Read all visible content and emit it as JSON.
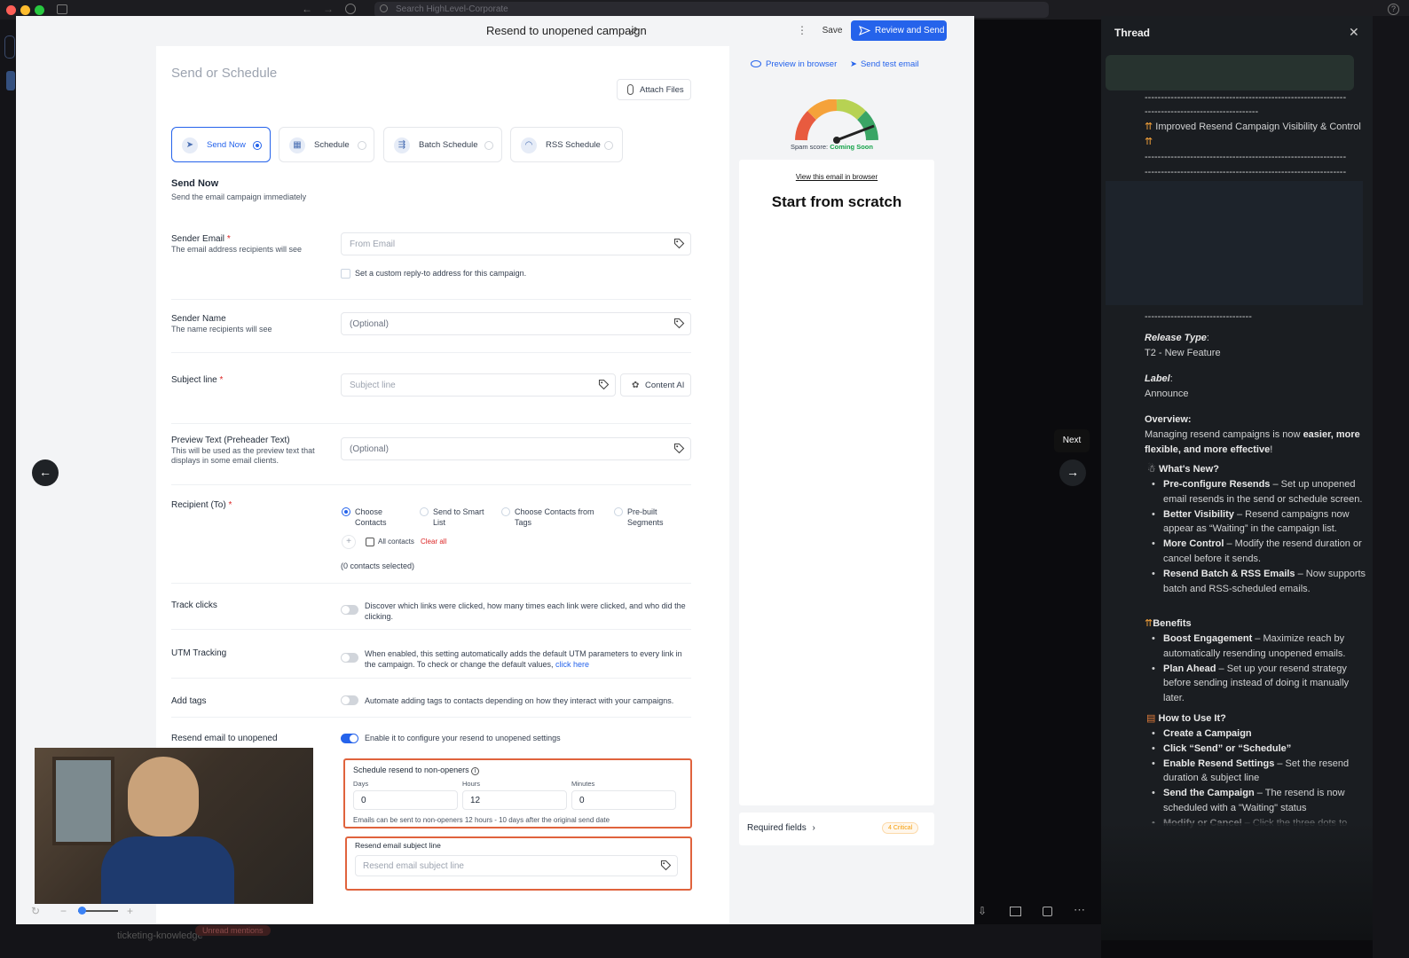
{
  "browser": {
    "search_placeholder": "Search HighLevel-Corporate"
  },
  "modal": {
    "title": "Resend to unopened campaign",
    "save": "Save",
    "review_send": "Review and Send",
    "preview_in_browser": "Preview in browser",
    "send_test": "Send test email",
    "attach_files": "Attach Files",
    "section_heading": "Send or Schedule"
  },
  "tabs": [
    {
      "label": "Send Now",
      "selected": true
    },
    {
      "label": "Schedule"
    },
    {
      "label": "Batch Schedule"
    },
    {
      "label": "RSS Schedule"
    }
  ],
  "send_now": {
    "title": "Send Now",
    "desc": "Send the email campaign immediately"
  },
  "fields": {
    "sender_email": {
      "label": "Sender Email",
      "desc": "The email address recipients will see",
      "placeholder": "From Email",
      "reply_to": "Set a custom reply-to address for this campaign."
    },
    "sender_name": {
      "label": "Sender Name",
      "desc": "The name recipients will see",
      "placeholder": "(Optional)"
    },
    "subject": {
      "label": "Subject line",
      "placeholder": "Subject line",
      "content_ai": "Content AI"
    },
    "preview_text": {
      "label": "Preview Text (Preheader Text)",
      "desc": "This will be used as the preview text that displays in some email clients.",
      "placeholder": "(Optional)"
    },
    "recipient": {
      "label": "Recipient (To)",
      "options": [
        "Choose Contacts",
        "Send to Smart List",
        "Choose Contacts from Tags",
        "Pre-built Segments"
      ],
      "all_contacts": "All contacts",
      "clear_all": "Clear all",
      "selected_count": "(0 contacts selected)"
    },
    "track_clicks": {
      "label": "Track clicks",
      "desc": "Discover which links were clicked, how many times each link were clicked, and who did the clicking."
    },
    "utm": {
      "label": "UTM Tracking",
      "desc": "When enabled, this setting automatically adds the default UTM parameters to every link in the campaign. To check or change the default values,",
      "link": "click here"
    },
    "add_tags": {
      "label": "Add tags",
      "desc": "Automate adding tags to contacts depending on how they interact with your campaigns."
    },
    "resend": {
      "label": "Resend email to unopened",
      "desc": "Enable it to configure your resend to unopened settings"
    }
  },
  "resend_box": {
    "title": "Schedule resend to non-openers",
    "days_label": "Days",
    "days": "0",
    "hours_label": "Hours",
    "hours": "12",
    "minutes_label": "Minutes",
    "minutes": "0",
    "note": "Emails can be sent to non-openers 12 hours - 10 days after the original send date",
    "subject_title": "Resend email subject line",
    "subject_placeholder": "Resend email subject line"
  },
  "preview": {
    "spam_label": "Spam score:",
    "spam_value": "Coming Soon",
    "view_in_browser": "View this email in browser",
    "heading": "Start from scratch",
    "required_fields": "Required fields",
    "critical": "4 Critical"
  },
  "nav": {
    "next_tooltip": "Next"
  },
  "thread": {
    "title": "Thread",
    "dashes1": "--------------------------------------------------------------",
    "dashes2": "-----------------------------------",
    "headline": "Improved Resend Campaign Visibility & Control",
    "dashes3": "--------------------------------------------------------------",
    "dashes4": "---------------------------------",
    "release_type_label": "Release Type",
    "release_type": "T2 - New Feature",
    "label_label": "Label",
    "label_value": "Announce",
    "overview_label": "Overview:",
    "overview_pre": "Managing resend campaigns is now",
    "overview_bold": "easier, more flexible, and more effective",
    "overview_post": "!",
    "whats_new": "What's New?",
    "whats_new_items": [
      {
        "b": "Pre-configure Resends",
        "t": " – Set up unopened email resends in the send or schedule screen."
      },
      {
        "b": "Better Visibility",
        "t": " – Resend campaigns now appear as “Waiting” in the campaign list."
      },
      {
        "b": "More Control",
        "t": " – Modify the resend duration or cancel before it sends."
      },
      {
        "b": "Resend Batch & RSS Emails",
        "t": " – Now supports batch and RSS-scheduled emails."
      }
    ],
    "benefits": "Benefits",
    "benefit_items": [
      {
        "b": "Boost Engagement",
        "t": " – Maximize reach by automatically resending unopened emails."
      },
      {
        "b": "Plan Ahead",
        "t": " – Set up your resend strategy before sending instead of doing it manually later."
      }
    ],
    "how_to": "How to Use It?",
    "how_items": [
      {
        "b": "Create a Campaign",
        "t": ""
      },
      {
        "b": "Click “Send” or “Schedule”",
        "t": ""
      },
      {
        "b": "Enable Resend Settings",
        "t": " – Set the resend duration & subject line"
      },
      {
        "b": "Send the Campaign",
        "t": " – The resend is now scheduled with a \"Waiting\" status"
      },
      {
        "b": "Modify or Cancel",
        "t": " – Click the three dots to"
      }
    ]
  },
  "bottom": {
    "channel": "ticketing-knowledge",
    "unread": "Unread mentions"
  }
}
